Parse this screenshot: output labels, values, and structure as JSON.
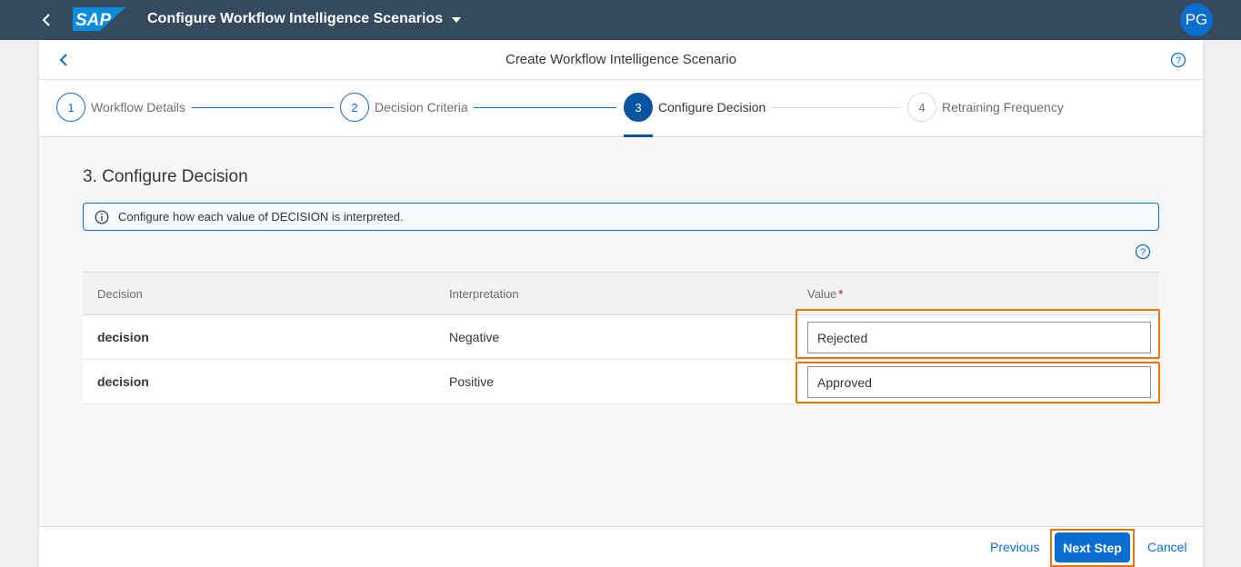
{
  "shell": {
    "logo_text": "SAP",
    "title": "Configure Workflow Intelligence Scenarios",
    "avatar_initials": "PG"
  },
  "dialog": {
    "title": "Create Workflow Intelligence Scenario"
  },
  "wizard": {
    "steps": [
      {
        "number": "1",
        "label": "Workflow Details",
        "state": "completed"
      },
      {
        "number": "2",
        "label": "Decision Criteria",
        "state": "completed"
      },
      {
        "number": "3",
        "label": "Configure Decision",
        "state": "active"
      },
      {
        "number": "4",
        "label": "Retraining Frequency",
        "state": "future"
      }
    ]
  },
  "content": {
    "section_title": "3. Configure Decision",
    "info_text": "Configure how each value of DECISION is interpreted."
  },
  "table": {
    "headers": {
      "decision": "Decision",
      "interpretation": "Interpretation",
      "value": "Value",
      "required_mark": "*"
    },
    "rows": [
      {
        "decision": "decision",
        "interpretation": "Negative",
        "value": "Rejected"
      },
      {
        "decision": "decision",
        "interpretation": "Positive",
        "value": "Approved"
      }
    ]
  },
  "footer": {
    "previous_label": "Previous",
    "next_label": "Next Step",
    "cancel_label": "Cancel"
  },
  "colors": {
    "shell_bg": "#354a5f",
    "brand_blue": "#0a6ed1",
    "active_step": "#0854a0",
    "highlight": "#e9730c",
    "required": "#bb0000"
  },
  "icons": [
    "back-icon",
    "sap-logo",
    "caret-down-icon",
    "help-icon",
    "info-icon"
  ]
}
